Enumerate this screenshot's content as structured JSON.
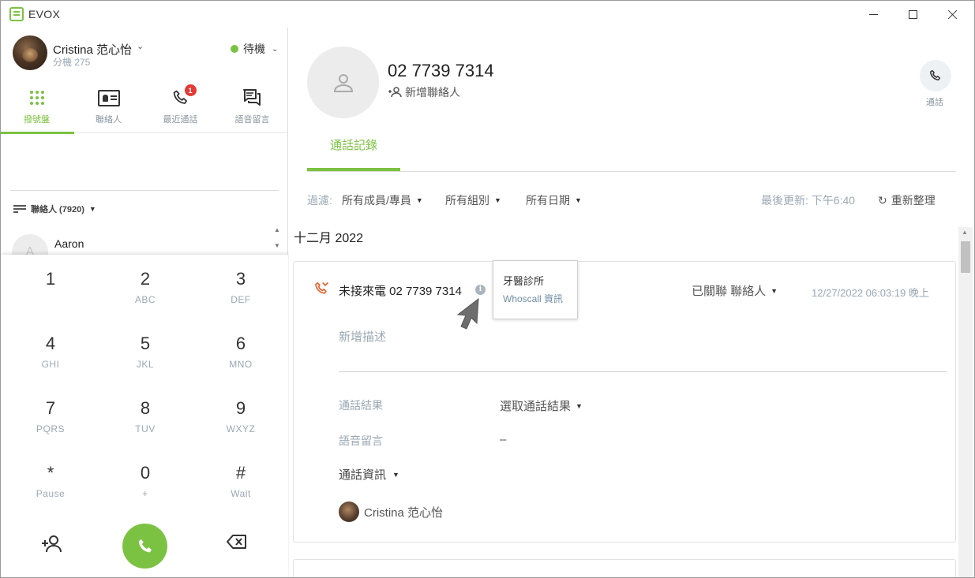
{
  "window": {
    "title": "EVOX",
    "accent": "#7cc242",
    "minimize_label": "",
    "maximize_label": "",
    "close_label": ""
  },
  "user": {
    "name": "Cristina 范心怡",
    "extension": "分機 275",
    "status": "待機"
  },
  "nav_tabs": [
    {
      "label": "撥號盤",
      "icon": "dialpad-icon",
      "active": true
    },
    {
      "label": "聯絡人",
      "icon": "contact-card-icon"
    },
    {
      "label": "最近通話",
      "icon": "phone-icon",
      "badge": "1"
    },
    {
      "label": "語音留言",
      "icon": "voicemail-chat-icon"
    }
  ],
  "contacts": {
    "filter_label": "聯絡人 (7920)",
    "first": {
      "name": "Aaron",
      "initial": "A"
    }
  },
  "dialpad": {
    "keys": [
      {
        "digit": "1",
        "letters": ""
      },
      {
        "digit": "2",
        "letters": "ABC"
      },
      {
        "digit": "3",
        "letters": "DEF"
      },
      {
        "digit": "4",
        "letters": "GHI"
      },
      {
        "digit": "5",
        "letters": "JKL"
      },
      {
        "digit": "6",
        "letters": "MNO"
      },
      {
        "digit": "7",
        "letters": "PQRS"
      },
      {
        "digit": "8",
        "letters": "TUV"
      },
      {
        "digit": "9",
        "letters": "WXYZ"
      },
      {
        "digit": "*",
        "letters": "Pause"
      },
      {
        "digit": "0",
        "letters": "+"
      },
      {
        "digit": "#",
        "letters": "Wait"
      }
    ]
  },
  "detail": {
    "phone_number": "02 7739 7314",
    "add_contact": "新增聯絡人",
    "call_label": "通話",
    "tab_history": "通話記錄",
    "filter": {
      "label": "過濾:",
      "members": "所有成員/專員",
      "groups": "所有組別",
      "dates": "所有日期",
      "last_updated": "最後更新: 下午6:40",
      "refresh": "重新整理"
    },
    "month": "十二月 2022",
    "record": {
      "type_text": "未接來電 02 7739 7314",
      "linked": "已關聯 聯絡人",
      "datetime": "12/27/2022 06:03:19 晚上",
      "description_placeholder": "新增描述",
      "result_label": "通話結果",
      "result_value": "選取通話結果",
      "voicemail_label": "語音留言",
      "voicemail_value": "–",
      "call_info": "通話資訊",
      "agent": "Cristina 范心怡"
    },
    "tooltip": {
      "name": "牙醫診所",
      "source": "Whoscall 資訊"
    }
  }
}
